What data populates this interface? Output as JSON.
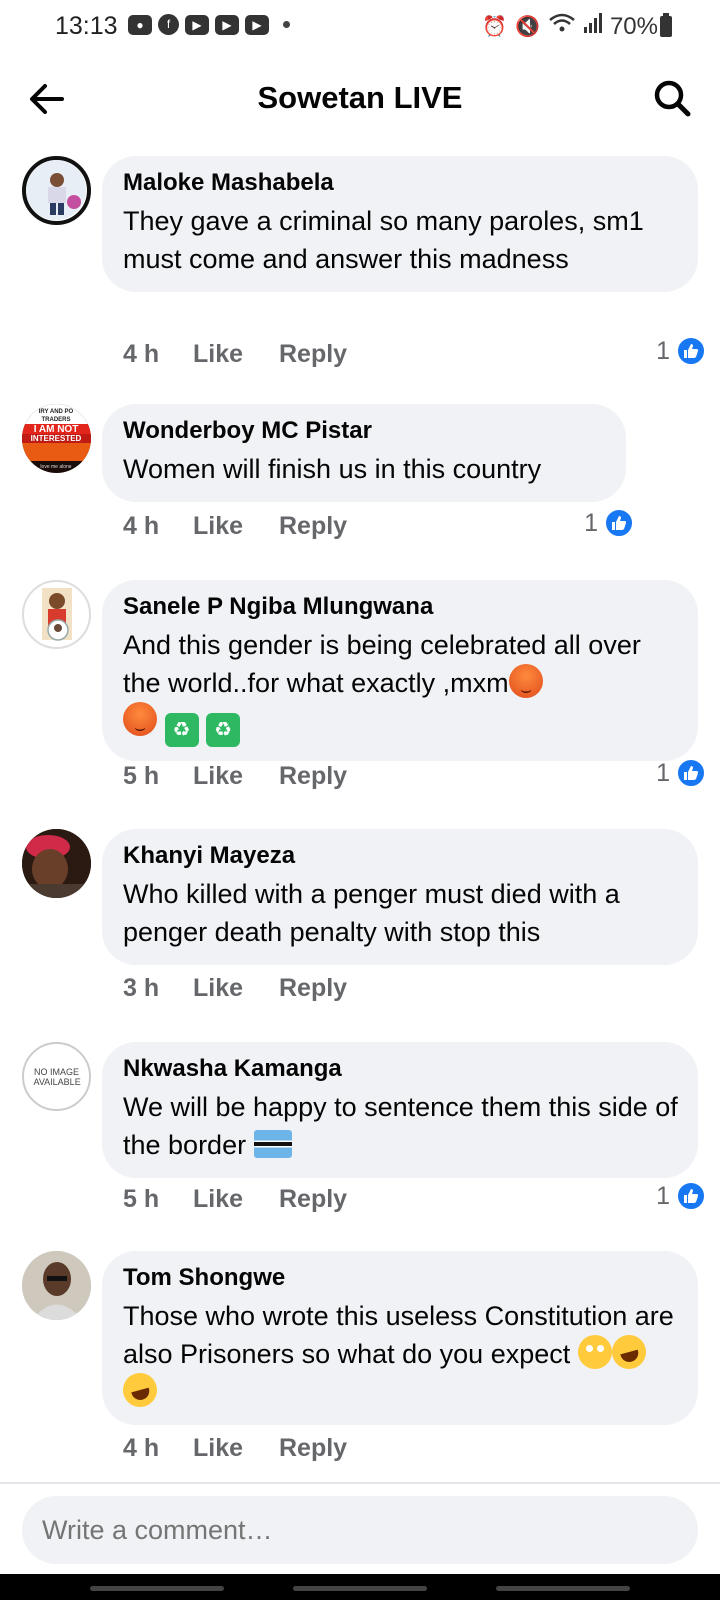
{
  "status_bar": {
    "time": "13:13",
    "battery": "70%",
    "left_icons": [
      "chat-icon",
      "facebook-icon",
      "youtube-icon",
      "youtube-icon",
      "youtube-icon"
    ],
    "right_icons": [
      "alarm-icon",
      "mute-icon",
      "wifi-icon",
      "signal-icon",
      "battery-icon"
    ]
  },
  "header": {
    "title": "Sowetan LIVE"
  },
  "actions": {
    "like": "Like",
    "reply": "Reply"
  },
  "comments": [
    {
      "author": "Maloke Mashabela",
      "text": "They gave a criminal so many paroles, sm1 must come and answer this madness",
      "time": "4 h",
      "like_count": "1"
    },
    {
      "author": "Wonderboy MC Pistar",
      "text": "Women will finish us in this country",
      "time": "4 h",
      "like_count": "1",
      "avatar_text": [
        "IRY AND PO",
        "TRADERS",
        "I AM NOT",
        "INTERESTED",
        "love me alone"
      ]
    },
    {
      "author": "Sanele P Ngiba Mlungwana",
      "text": "And this gender is being celebrated all over the world..for what exactly ,mxm",
      "time": "5 h",
      "like_count": "1",
      "emojis": [
        "angry-face",
        "angry-face",
        "litter-bin",
        "litter-bin"
      ]
    },
    {
      "author": "Khanyi Mayeza",
      "text": "Who killed with a penger must died with a penger death penalty with stop this",
      "time": "3 h"
    },
    {
      "author": "Nkwasha Kamanga",
      "text": "We will be happy to sentence them this side of the border",
      "time": "5 h",
      "like_count": "1",
      "avatar_text": "NO IMAGE AVAILABLE",
      "emojis": [
        "botswana-flag"
      ]
    },
    {
      "author": "Tom Shongwe",
      "text": "Those who wrote this useless Constitution are also Prisoners so what do you expect",
      "time": "4 h",
      "emojis": [
        "eye-roll",
        "rolling-laughing",
        "rolling-laughing"
      ]
    }
  ],
  "composer": {
    "placeholder": "Write a comment…"
  },
  "colors": {
    "bubble": "#f0f2f5",
    "meta_text": "#65676b",
    "like_blue": "#1877f2"
  }
}
